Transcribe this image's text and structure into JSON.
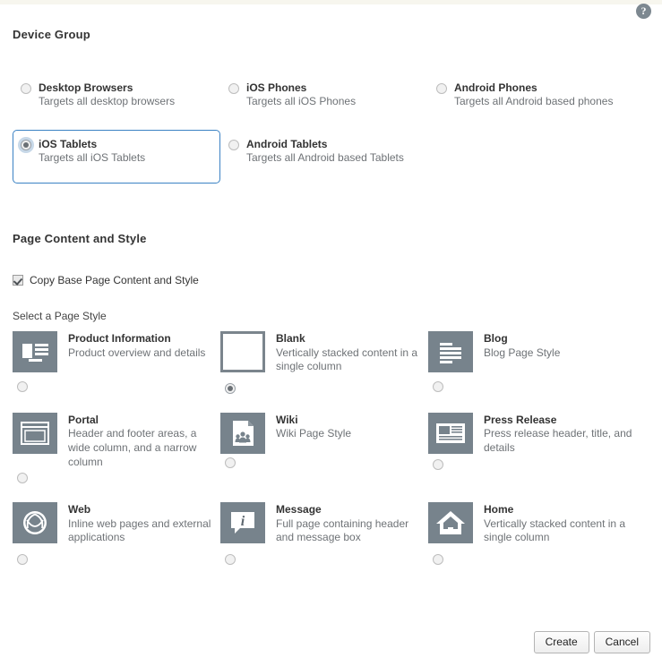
{
  "top": {
    "help_icon": "help-icon",
    "help_label": "?"
  },
  "device_group": {
    "title": "Device Group",
    "options": [
      {
        "name": "Desktop Browsers",
        "desc": "Targets all desktop browsers",
        "selected": false
      },
      {
        "name": "iOS Phones",
        "desc": "Targets all iOS Phones",
        "selected": false
      },
      {
        "name": "Android Phones",
        "desc": "Targets all Android based phones",
        "selected": false
      },
      {
        "name": "iOS Tablets",
        "desc": "Targets all iOS Tablets",
        "selected": true
      },
      {
        "name": "Android Tablets",
        "desc": "Targets all Android based Tablets",
        "selected": false
      }
    ]
  },
  "page_content_and_style": {
    "title": "Page Content and Style",
    "copy_base_checkbox": {
      "label": "Copy Base Page Content and Style",
      "checked": true
    },
    "select_style_label": "Select a Page Style",
    "styles": [
      {
        "name": "Product Information",
        "desc": "Product overview and details",
        "icon": "product-information-icon",
        "selected": false
      },
      {
        "name": "Blank",
        "desc": "Vertically stacked content in a single column",
        "icon": "blank-page-icon",
        "selected": true
      },
      {
        "name": "Blog",
        "desc": "Blog Page Style",
        "icon": "blog-icon",
        "selected": false
      },
      {
        "name": "Portal",
        "desc": "Header and footer areas, a wide column, and a narrow column",
        "icon": "portal-window-icon",
        "selected": false
      },
      {
        "name": "Wiki",
        "desc": "Wiki Page Style",
        "icon": "wiki-document-icon",
        "selected": false
      },
      {
        "name": "Press Release",
        "desc": "Press release header, title, and details",
        "icon": "press-release-icon",
        "selected": false
      },
      {
        "name": "Web",
        "desc": "Inline web pages and external applications",
        "icon": "web-globe-icon",
        "selected": false
      },
      {
        "name": "Message",
        "desc": "Full page containing header and message box",
        "icon": "message-bubble-icon",
        "selected": false
      },
      {
        "name": "Home",
        "desc": "Vertically stacked content in a single column",
        "icon": "home-house-icon",
        "selected": false
      }
    ]
  },
  "footer": {
    "create_label": "Create",
    "cancel_label": "Cancel"
  },
  "colors": {
    "accent_border": "#3b82c4",
    "tile_bg": "#77838c",
    "text": "#333333",
    "muted_text": "#6e7276",
    "top_strip": "#f7f6ee"
  }
}
